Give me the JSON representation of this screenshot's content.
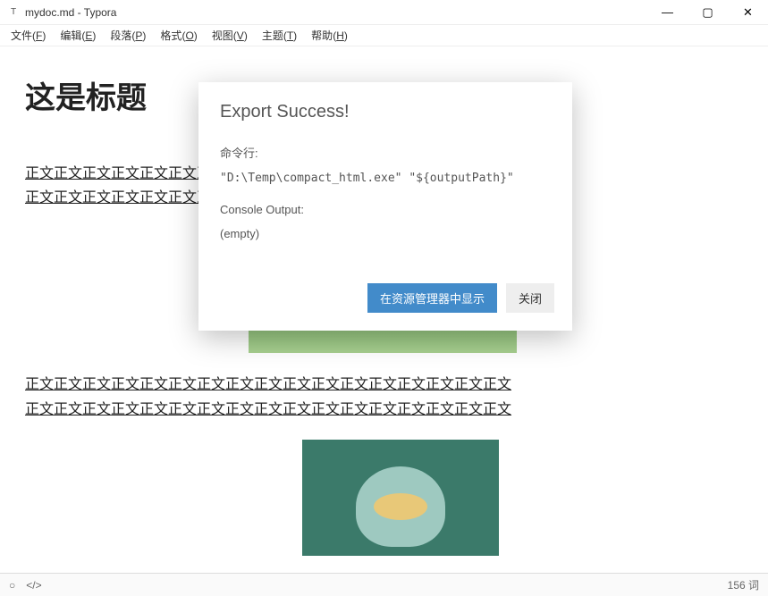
{
  "titlebar": {
    "title": "mydoc.md - Typora",
    "icon_label": "T"
  },
  "window_controls": {
    "minimize": "—",
    "maximize": "▢",
    "close": "✕"
  },
  "menubar": {
    "items": [
      {
        "label": "文件",
        "hotkey": "F"
      },
      {
        "label": "编辑",
        "hotkey": "E"
      },
      {
        "label": "段落",
        "hotkey": "P"
      },
      {
        "label": "格式",
        "hotkey": "O"
      },
      {
        "label": "视图",
        "hotkey": "V"
      },
      {
        "label": "主题",
        "hotkey": "T"
      },
      {
        "label": "帮助",
        "hotkey": "H"
      }
    ]
  },
  "document": {
    "heading": "这是标题",
    "paragraph1": "正文正文正文正文正文正文正文正文正文正文正文正文正文正文正文正文正文正文正文正文正文正文正文正文正文正文正文正文正文正文正文正文正文正文",
    "paragraph2": "正文正文正文正文正文正文正文正文正文正文正文正文正文正文正文正文正文正文正文正文正文正文正文正文正文正文正文正文正文正文正文正文正文正文"
  },
  "dialog": {
    "title": "Export Success!",
    "command_label": "命令行:",
    "command_value": "\"D:\\Temp\\compact_html.exe\" \"${outputPath}\"",
    "console_label": "Console Output:",
    "console_value": "(empty)",
    "buttons": {
      "reveal": "在资源管理器中显示",
      "close": "关闭"
    }
  },
  "statusbar": {
    "word_count": "156 词"
  }
}
